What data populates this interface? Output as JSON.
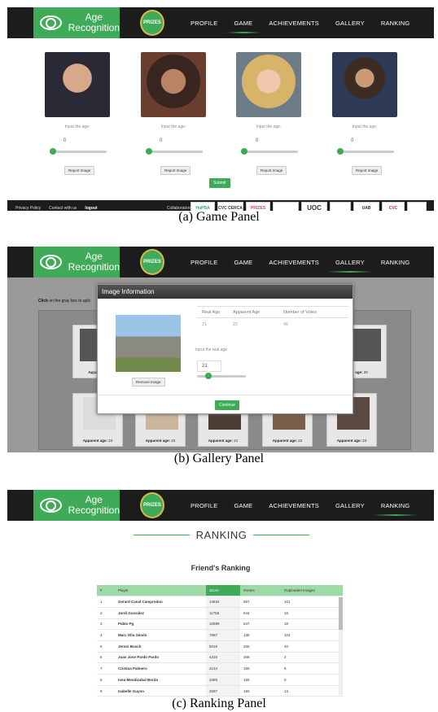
{
  "nav": {
    "logo_line1": "Age",
    "logo_line2": "Recognition",
    "prizes": "PRIZES",
    "items": [
      "PROFILE",
      "GAME",
      "ACHIEVEMENTS",
      "GALLERY",
      "RANKING"
    ]
  },
  "game": {
    "input_label": "Input the age:",
    "default_age": "0",
    "report_label": "Report Image",
    "submit_label": "Submit",
    "footer": {
      "privacy": "Privacy Policy",
      "contact": "Contact with us",
      "logout": "logout",
      "collaborators": "Collaborators:"
    },
    "collaborator_logos": [
      "HuPBA",
      "CVC CERCA",
      "PRIZES",
      "",
      "UOC",
      "",
      "UAB",
      "CVC",
      ""
    ],
    "caption": "(a)  Game Panel"
  },
  "gallery": {
    "instruction_bold": "Click",
    "instruction_rest": " on the gray box to uplo",
    "modal_title": "Image Information",
    "col_real": "Real Age",
    "col_apparent": "Apparent Age",
    "col_votes": "Number of Votes",
    "val_real": "21",
    "val_apparent": "22",
    "val_votes": "45",
    "input_real_label": "Input the real age",
    "input_real_value": "21",
    "remove_label": "Remove Image",
    "continue_label": "Continue",
    "apparent_prefix": "Apparent age:",
    "row1_left": "Apparent a",
    "row1_right_suffix": "age:",
    "row1_right_value": "20",
    "bottom_ages": [
      "23",
      "23",
      "21",
      "22",
      "23"
    ],
    "caption": "(b)  Gallery Panel"
  },
  "ranking": {
    "heading": "RANKING",
    "subheading": "Friend's Ranking",
    "columns": [
      "#",
      "Player",
      "Score",
      "#Votes",
      "#Uploaded Images"
    ],
    "rows": [
      [
        "1",
        "Gerard Canal Camprodon",
        "14834",
        "687",
        "101"
      ],
      [
        "2",
        "Jordi González",
        "11755",
        "644",
        "16"
      ],
      [
        "3",
        "Pablo Pg",
        "10699",
        "647",
        "18"
      ],
      [
        "4",
        "Marc Oliu Simón",
        "7587",
        "136",
        "104"
      ],
      [
        "5",
        "Jeroni Bosch",
        "6018",
        "266",
        "40"
      ],
      [
        "6",
        "Juan Jose Pardo Pardo",
        "4315",
        "268",
        "2"
      ],
      [
        "7",
        "Cristina Palmero",
        "4124",
        "155",
        "8"
      ],
      [
        "8",
        "Iosu Mendizabal Borda",
        "3489",
        "156",
        "0"
      ],
      [
        "9",
        "Isabelle Guyon",
        "3297",
        "180",
        "13"
      ]
    ],
    "caption": "(c)  Ranking Panel"
  },
  "colors": {
    "green": "#3faa57",
    "nav": "#1c1c1c",
    "overlay": "#9a9a9a"
  }
}
